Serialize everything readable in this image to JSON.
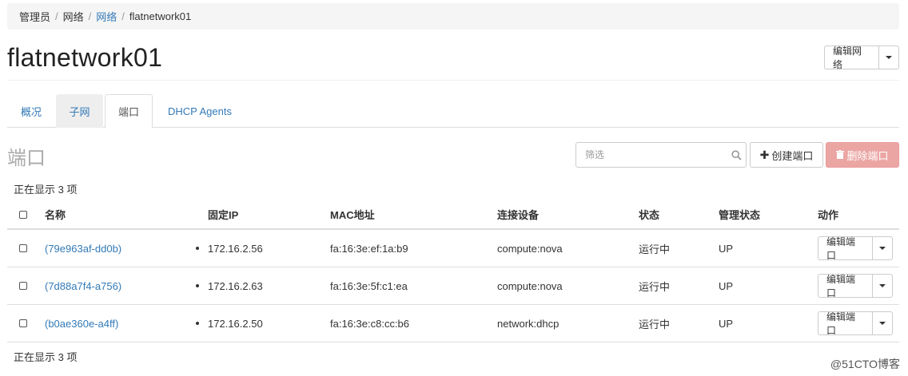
{
  "breadcrumb": {
    "item1": "管理员",
    "item2": "网络",
    "item3": "网络",
    "item4": "flatnetwork01",
    "separator": "/"
  },
  "page": {
    "title": "flatnetwork01"
  },
  "header_actions": {
    "edit_network_label": "编辑网络"
  },
  "tabs": [
    {
      "label": "概况"
    },
    {
      "label": "子网"
    },
    {
      "label": "端口"
    },
    {
      "label": "DHCP Agents"
    }
  ],
  "section": {
    "title": "端口"
  },
  "filter": {
    "placeholder": "筛选",
    "value": ""
  },
  "toolbar": {
    "create_label": "创建端口",
    "delete_label": "删除端口"
  },
  "count_text_top": "正在显示 3 项",
  "count_text_bottom": "正在显示 3 项",
  "table": {
    "headers": {
      "name": "名称",
      "fixed_ip": "固定IP",
      "mac": "MAC地址",
      "device": "连接设备",
      "status": "状态",
      "admin_state": "管理状态",
      "actions": "动作"
    },
    "rows": [
      {
        "name": "(79e963af-dd0b)",
        "ip": "172.16.2.56",
        "mac": "fa:16:3e:ef:1a:b9",
        "device": "compute:nova",
        "status": "运行中",
        "admin_state": "UP",
        "action": "编辑端口"
      },
      {
        "name": "(7d88a7f4-a756)",
        "ip": "172.16.2.63",
        "mac": "fa:16:3e:5f:c1:ea",
        "device": "compute:nova",
        "status": "运行中",
        "admin_state": "UP",
        "action": "编辑端口"
      },
      {
        "name": "(b0ae360e-a4ff)",
        "ip": "172.16.2.50",
        "mac": "fa:16:3e:c8:cc:b6",
        "device": "network:dhcp",
        "status": "运行中",
        "admin_state": "UP",
        "action": "编辑端口"
      }
    ]
  },
  "watermark": "@51CTO博客",
  "icons": {
    "search": "search-icon",
    "plus": "plus-icon",
    "trash": "trash-icon",
    "caret": "chevron-down-icon"
  },
  "colors": {
    "link": "#337ab7",
    "danger_disabled": "#eba6a4"
  }
}
